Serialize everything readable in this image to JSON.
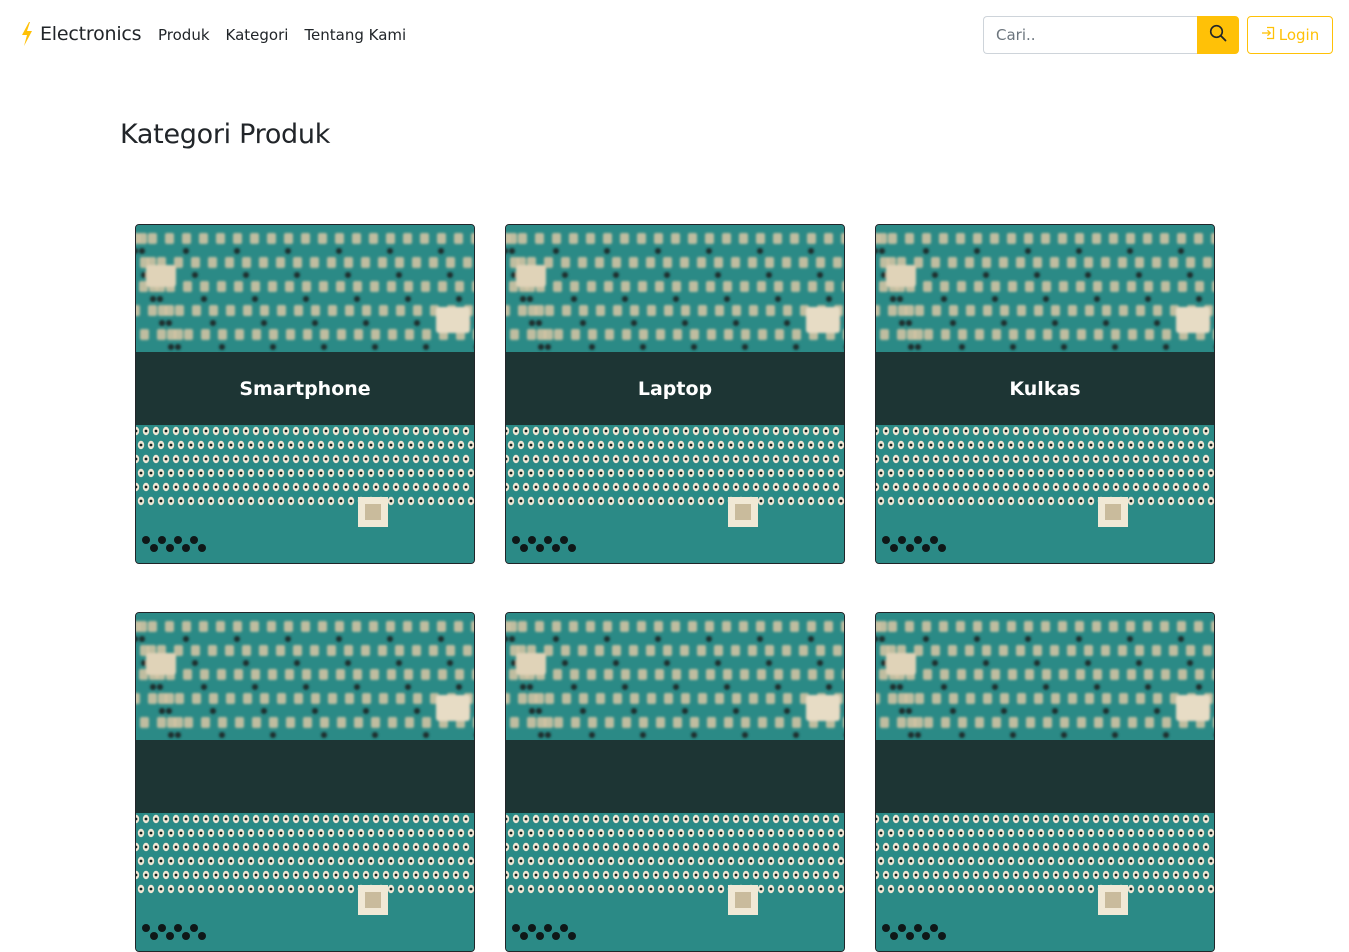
{
  "brand": {
    "name": "Electronics",
    "icon": "lightning-icon",
    "icon_color": "#ffc107"
  },
  "nav": {
    "links": [
      {
        "label": "Produk"
      },
      {
        "label": "Kategori"
      },
      {
        "label": "Tentang Kami"
      }
    ]
  },
  "search": {
    "placeholder": "Cari..",
    "value": "",
    "button_icon": "search-icon"
  },
  "login": {
    "label": "Login",
    "icon": "login-icon"
  },
  "page": {
    "title": "Kategori Produk"
  },
  "categories": [
    {
      "label": "Smartphone"
    },
    {
      "label": "Laptop"
    },
    {
      "label": "Kulkas"
    },
    {
      "label": ""
    },
    {
      "label": ""
    },
    {
      "label": ""
    }
  ],
  "colors": {
    "accent": "#ffc107",
    "text": "#212529",
    "card_band": "#1e2424"
  }
}
